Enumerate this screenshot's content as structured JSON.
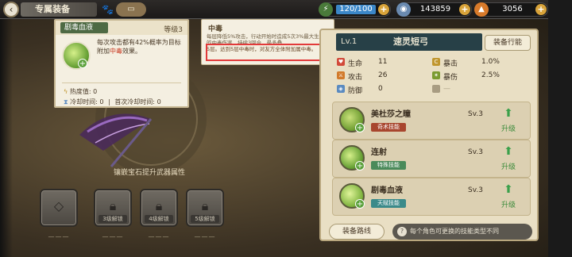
{
  "header": {
    "title": "专属装备",
    "currency1": "120/100",
    "currency2": "143859",
    "currency3": "3056"
  },
  "tooltip_skill": {
    "name": "剧毒血液",
    "level": "等级3",
    "desc_prefix": "每次攻击都有42%概率为目标附加",
    "desc_highlight": "中毒",
    "desc_suffix": "效果。",
    "heat_label": "热度值:",
    "heat_value": "0",
    "cooldown_label": "冷却时间:",
    "cooldown_value": "0",
    "first_cd_label": "首次冷却时间:",
    "first_cd_value": "0"
  },
  "tooltip_status": {
    "title": "中毒",
    "text_top": "每层降低5%攻击，行动开始时造成5次3%最大生命值的中毒伤害，持续3回合，最多叠",
    "text_boxed": "5层。达到5层中毒时，对友方全体附加属中毒。"
  },
  "weapon": {
    "level": "Lv.1",
    "name": "速灵短弓",
    "skill_switch": "装备行能"
  },
  "stats": [
    {
      "name": "生命",
      "value": "11",
      "color": "#d24a3a",
      "icon": "heart-icon"
    },
    {
      "name": "暴击",
      "value": "1.0%",
      "color": "#c0962e",
      "icon": "crit-icon"
    },
    {
      "name": "攻击",
      "value": "26",
      "color": "#d27a2a",
      "icon": "sword-icon"
    },
    {
      "name": "暴伤",
      "value": "2.5%",
      "color": "#7a9a2e",
      "icon": "crit-damage-icon"
    },
    {
      "name": "防御",
      "value": "0",
      "color": "#5a8ac0",
      "icon": "shield-icon"
    },
    {
      "name": "",
      "value": "",
      "color": "#a89c82",
      "icon": "empty-icon"
    }
  ],
  "gem_hint": "镶嵌宝石提升武器属性",
  "slots": [
    {
      "label": "",
      "icon": "diamond-icon"
    },
    {
      "label": "3级解锁",
      "icon": "lock-icon"
    },
    {
      "label": "4级解锁",
      "icon": "lock-icon"
    },
    {
      "label": "5级解锁",
      "icon": "lock-icon"
    }
  ],
  "skills": [
    {
      "name": "美杜莎之瞳",
      "tag": "奇术技能",
      "tag_color": "#a8462e",
      "level": "Sv.3",
      "up": "升级",
      "icon_bg": "#8aba3a"
    },
    {
      "name": "连射",
      "tag": "特殊技能",
      "tag_color": "#4a8a5a",
      "level": "Sv.3",
      "up": "升级",
      "icon_bg": "#6aa03a"
    },
    {
      "name": "剧毒血液",
      "tag": "天赋技能",
      "tag_color": "#3a8a8a",
      "level": "Sv.3",
      "up": "升级",
      "icon_bg": "#8ac03a"
    }
  ],
  "footer": {
    "route_btn": "装备路线",
    "note": "每个角色可更换的技能类型不同"
  }
}
